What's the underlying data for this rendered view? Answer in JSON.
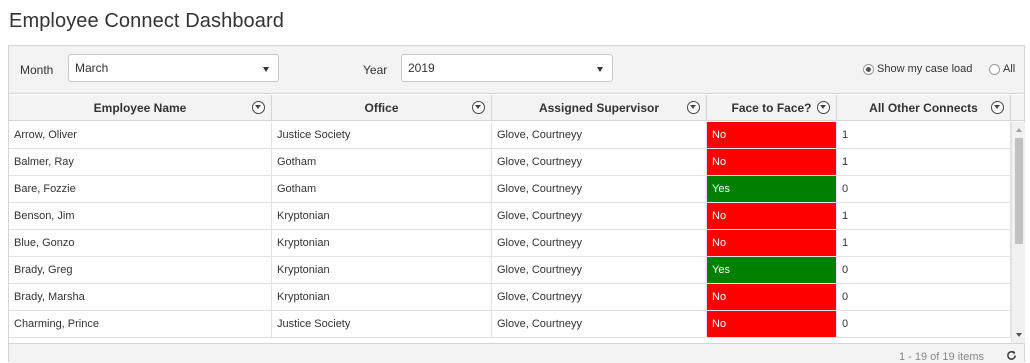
{
  "page": {
    "title": "Employee Connect Dashboard"
  },
  "filters": {
    "month_label": "Month",
    "month_value": "March",
    "year_label": "Year",
    "year_value": "2019",
    "caseload_option": "Show my case load",
    "caseload_selected": true,
    "all_option": "All",
    "all_selected": false
  },
  "grid": {
    "columns": [
      {
        "label": "Employee Name"
      },
      {
        "label": "Office"
      },
      {
        "label": "Assigned Supervisor"
      },
      {
        "label": "Face to Face?"
      },
      {
        "label": "All Other Connects"
      }
    ],
    "rows": [
      {
        "name": "Arrow, Oliver",
        "office": "Justice Society",
        "supervisor": "Glove, Courtneyy",
        "face": "No",
        "other": "1"
      },
      {
        "name": "Balmer, Ray",
        "office": "Gotham",
        "supervisor": "Glove, Courtneyy",
        "face": "No",
        "other": "1"
      },
      {
        "name": "Bare, Fozzie",
        "office": "Gotham",
        "supervisor": "Glove, Courtneyy",
        "face": "Yes",
        "other": "0"
      },
      {
        "name": "Benson, Jim",
        "office": "Kryptonian",
        "supervisor": "Glove, Courtneyy",
        "face": "No",
        "other": "1"
      },
      {
        "name": "Blue, Gonzo",
        "office": "Kryptonian",
        "supervisor": "Glove, Courtneyy",
        "face": "No",
        "other": "1"
      },
      {
        "name": "Brady, Greg",
        "office": "Kryptonian",
        "supervisor": "Glove, Courtneyy",
        "face": "Yes",
        "other": "0"
      },
      {
        "name": "Brady, Marsha",
        "office": "Kryptonian",
        "supervisor": "Glove, Courtneyy",
        "face": "No",
        "other": "0"
      },
      {
        "name": "Charming, Prince",
        "office": "Justice Society",
        "supervisor": "Glove, Courtneyy",
        "face": "No",
        "other": "0"
      }
    ],
    "status_colors": {
      "No": "#ff0000",
      "Yes": "#008000"
    }
  },
  "footer": {
    "pager_info": "1 - 19 of 19 items"
  },
  "icons": {
    "dropdown": "chevron-down-icon",
    "column_filter": "filter-icon",
    "refresh": "refresh-icon"
  }
}
